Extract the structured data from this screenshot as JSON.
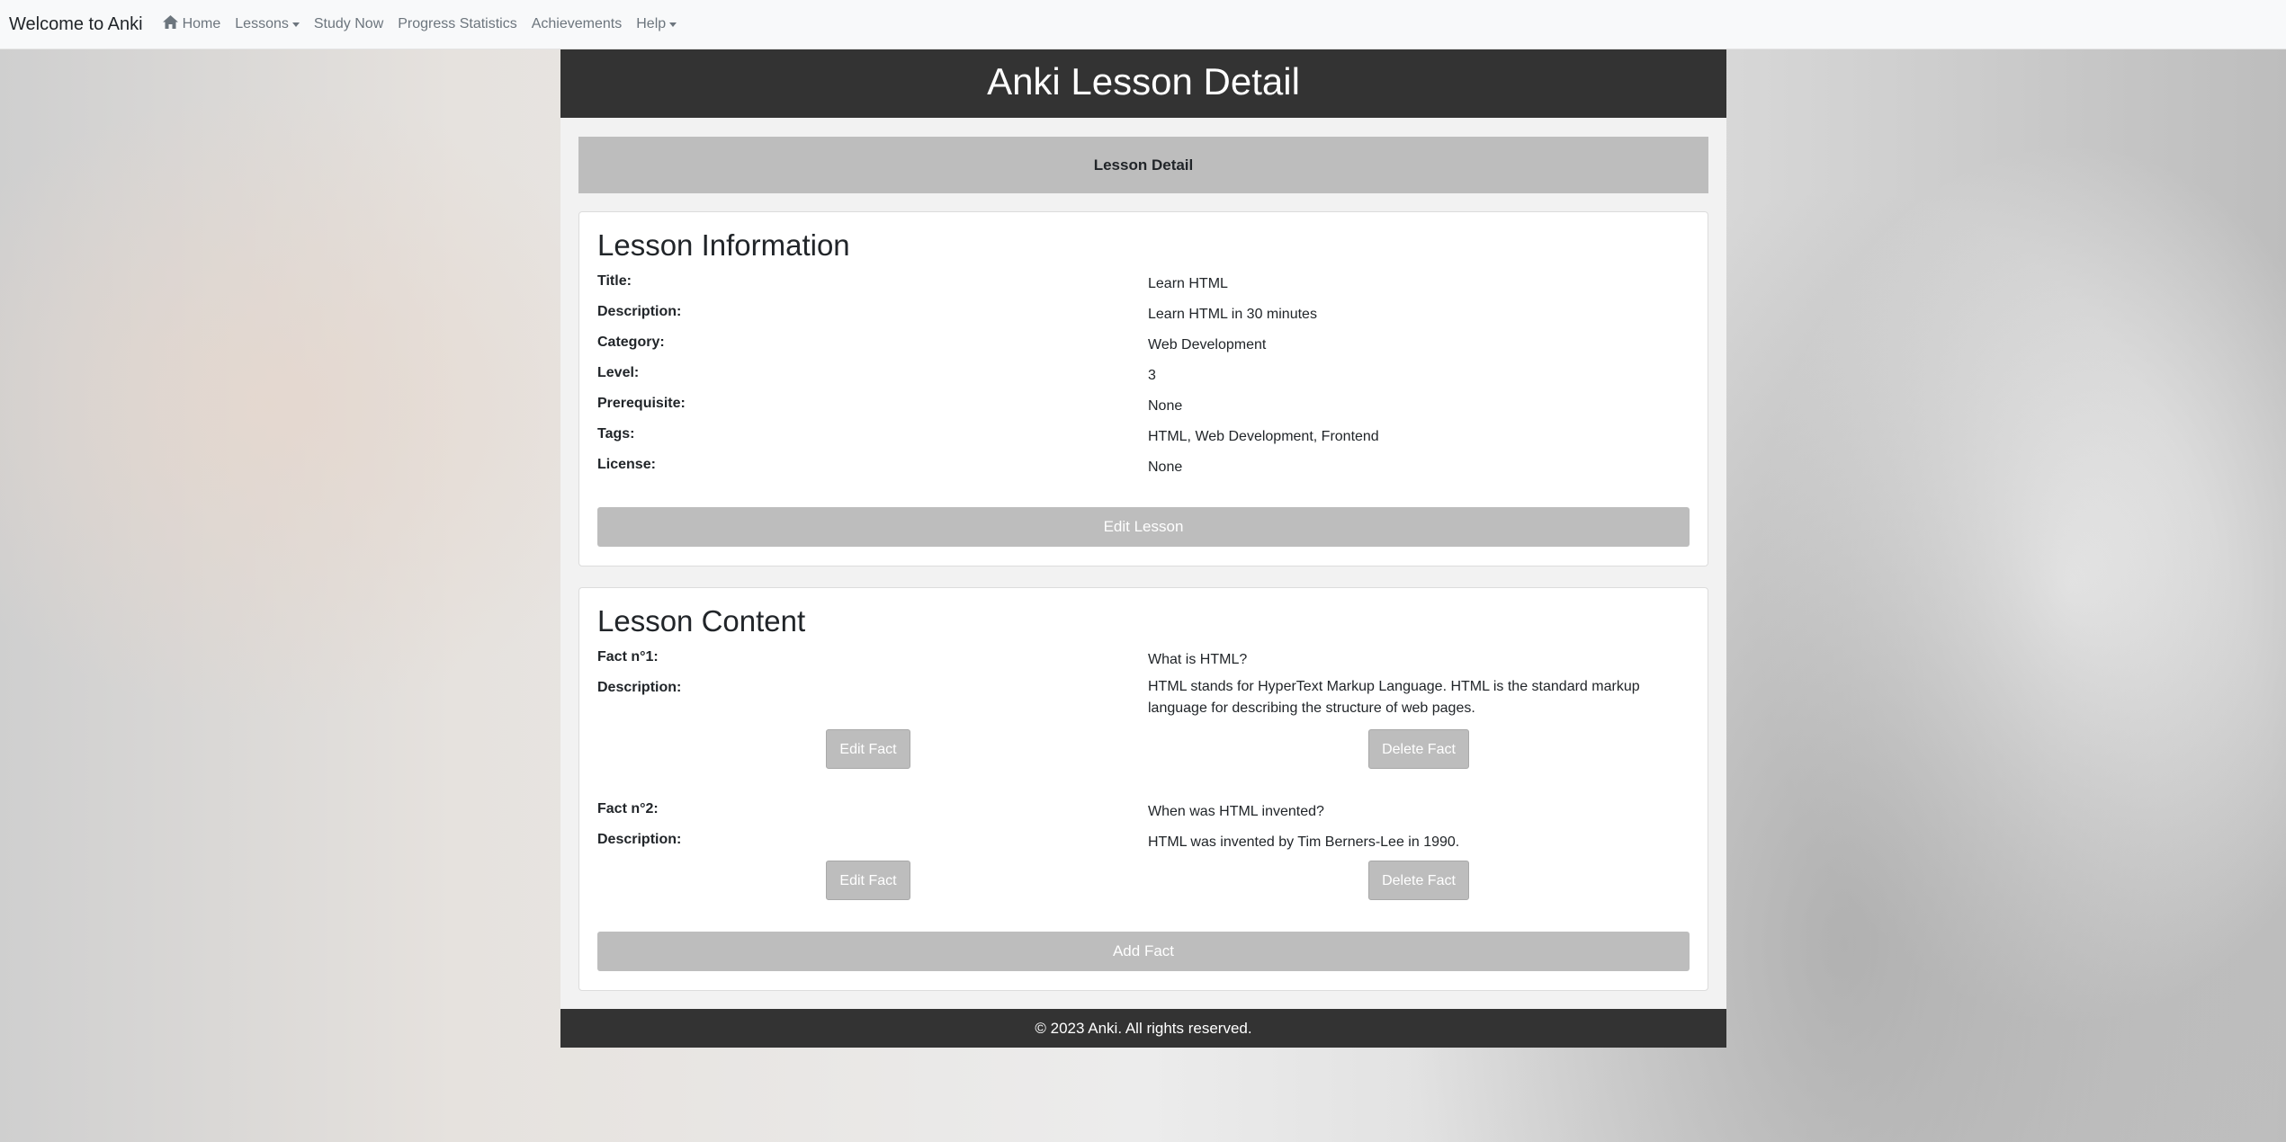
{
  "navbar": {
    "brand": "Welcome to Anki",
    "items": [
      {
        "label": "Home"
      },
      {
        "label": "Lessons"
      },
      {
        "label": "Study Now"
      },
      {
        "label": "Progress Statistics"
      },
      {
        "label": "Achievements"
      },
      {
        "label": "Help"
      }
    ]
  },
  "header": {
    "title": "Anki Lesson Detail"
  },
  "subbar": {
    "label": "Lesson Detail"
  },
  "info": {
    "heading": "Lesson Information",
    "fields": [
      {
        "label": "Title:",
        "value": "Learn HTML"
      },
      {
        "label": "Description:",
        "value": "Learn HTML in 30 minutes"
      },
      {
        "label": "Category:",
        "value": "Web Development"
      },
      {
        "label": "Level:",
        "value": "3"
      },
      {
        "label": "Prerequisite:",
        "value": "None"
      },
      {
        "label": "Tags:",
        "value": "HTML, Web Development, Frontend"
      },
      {
        "label": "License:",
        "value": "None"
      }
    ],
    "edit_button": "Edit Lesson"
  },
  "content": {
    "heading": "Lesson Content",
    "facts": [
      {
        "fact_label": "Fact n°1:",
        "fact_value": "What is HTML?",
        "desc_label": "Description:",
        "desc_value": "HTML stands for HyperText Markup Language. HTML is the standard markup language for describing the structure of web pages.",
        "edit": "Edit Fact",
        "delete": "Delete Fact"
      },
      {
        "fact_label": "Fact n°2:",
        "fact_value": "When was HTML invented?",
        "desc_label": "Description:",
        "desc_value": "HTML was invented by Tim Berners-Lee in 1990.",
        "edit": "Edit Fact",
        "delete": "Delete Fact"
      }
    ],
    "add_button": "Add Fact"
  },
  "footer": {
    "text": "© 2023 Anki. All rights reserved."
  },
  "colors": {
    "dark": "#333333",
    "button_gray": "#bdbdbd",
    "nav_bg": "#f8f9fa"
  }
}
